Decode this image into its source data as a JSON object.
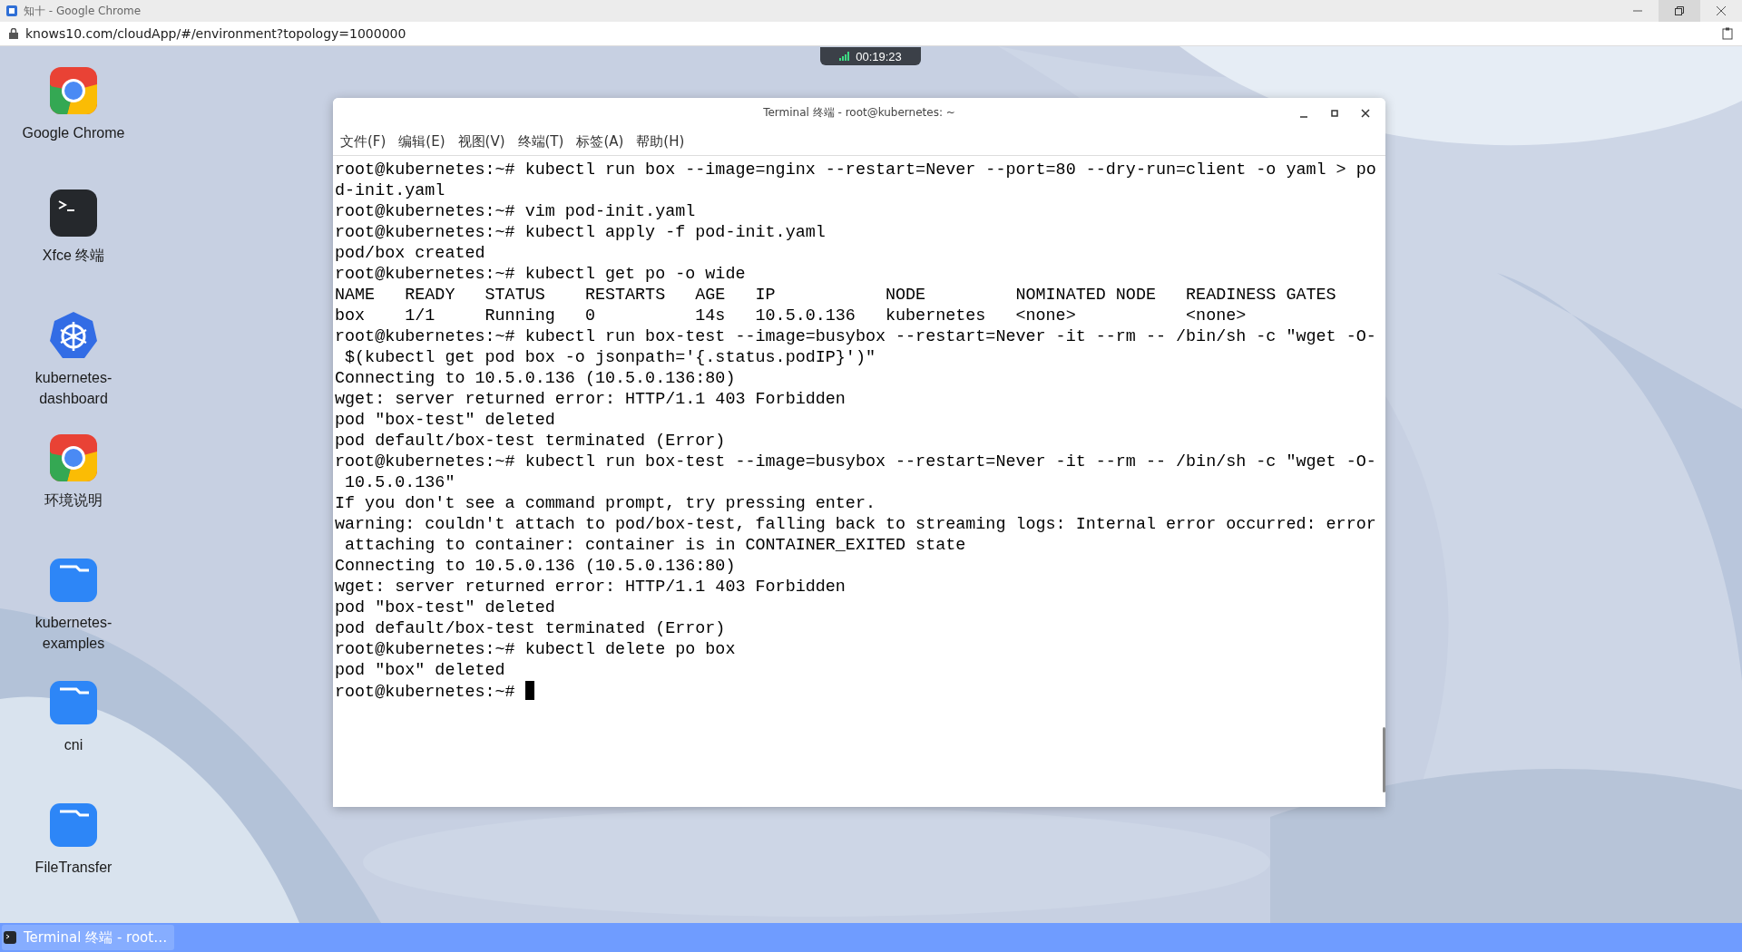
{
  "browser": {
    "title": "知十 - Google Chrome",
    "url": "knows10.com/cloudApp/#/environment?topology=1000000"
  },
  "session_timer": "00:19:23",
  "desktop_icons": [
    {
      "label": "Google Chrome",
      "kind": "chrome"
    },
    {
      "label": "Xfce 终端",
      "kind": "terminal"
    },
    {
      "label": "kubernetes-dashboard",
      "kind": "kubernetes"
    },
    {
      "label": "环境说明",
      "kind": "chrome"
    },
    {
      "label": "kubernetes-examples",
      "kind": "folder"
    },
    {
      "label": "cni",
      "kind": "folder"
    },
    {
      "label": "FileTransfer",
      "kind": "folder"
    }
  ],
  "terminal_window": {
    "title": "Terminal 终端 - root@kubernetes: ~",
    "menu": [
      "文件(F)",
      "编辑(E)",
      "视图(V)",
      "终端(T)",
      "标签(A)",
      "帮助(H)"
    ],
    "lines": [
      "root@kubernetes:~# kubectl run box --image=nginx --restart=Never --port=80 --dry-run=client -o yaml > po",
      "d-init.yaml",
      "root@kubernetes:~# vim pod-init.yaml",
      "root@kubernetes:~# kubectl apply -f pod-init.yaml",
      "pod/box created",
      "root@kubernetes:~# kubectl get po -o wide",
      "NAME   READY   STATUS    RESTARTS   AGE   IP           NODE         NOMINATED NODE   READINESS GATES",
      "box    1/1     Running   0          14s   10.5.0.136   kubernetes   <none>           <none>",
      "root@kubernetes:~# kubectl run box-test --image=busybox --restart=Never -it --rm -- /bin/sh -c \"wget -O-",
      " $(kubectl get pod box -o jsonpath='{.status.podIP}')\"",
      "Connecting to 10.5.0.136 (10.5.0.136:80)",
      "wget: server returned error: HTTP/1.1 403 Forbidden",
      "pod \"box-test\" deleted",
      "pod default/box-test terminated (Error)",
      "root@kubernetes:~# kubectl run box-test --image=busybox --restart=Never -it --rm -- /bin/sh -c \"wget -O-",
      " 10.5.0.136\"",
      "If you don't see a command prompt, try pressing enter.",
      "warning: couldn't attach to pod/box-test, falling back to streaming logs: Internal error occurred: error",
      " attaching to container: container is in CONTAINER_EXITED state",
      "Connecting to 10.5.0.136 (10.5.0.136:80)",
      "wget: server returned error: HTTP/1.1 403 Forbidden",
      "pod \"box-test\" deleted",
      "pod default/box-test terminated (Error)",
      "root@kubernetes:~# kubectl delete po box",
      "pod \"box\" deleted",
      "root@kubernetes:~#"
    ],
    "cursor": true
  },
  "taskbar": {
    "items": [
      {
        "label": "Terminal 终端 - root…",
        "selected": true
      }
    ]
  }
}
